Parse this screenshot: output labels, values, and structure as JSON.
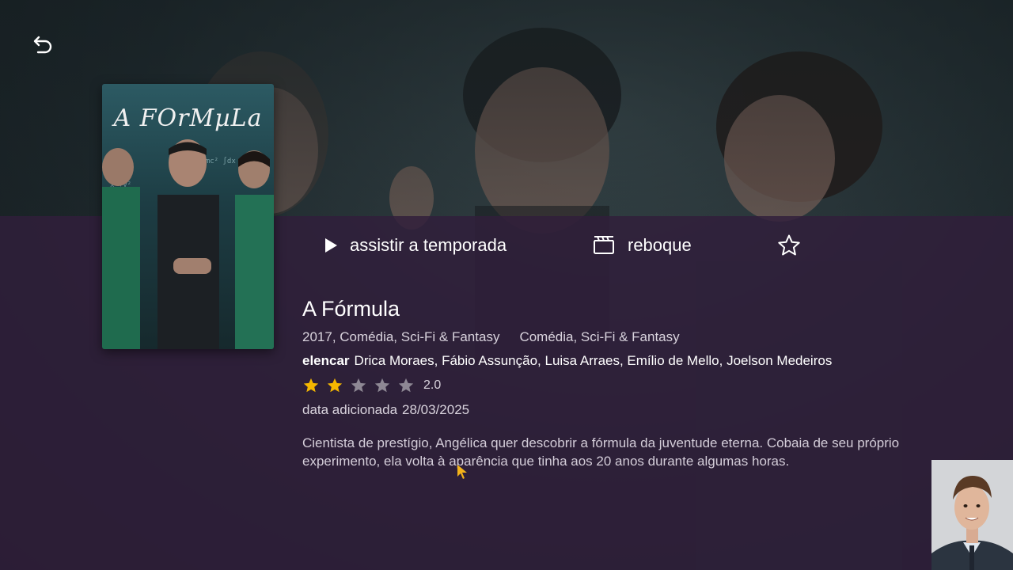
{
  "show": {
    "title": "A Fórmula",
    "poster_title": "A FOrMµLa",
    "year_genres": "2017, Comédia, Sci-Fi & Fantasy",
    "genres": "Comédia, Sci-Fi & Fantasy",
    "cast_label": "elencar",
    "cast": "Drica Moraes, Fábio Assunção, Luisa Arraes, Emílio de Mello, Joelson Medeiros",
    "rating": 2.0,
    "rating_text": "2.0",
    "rating_max_stars": 5,
    "date_label": "data adicionada",
    "date_added": "28/03/2025",
    "synopsis": "Cientista de prestígio, Angélica quer descobrir a fórmula da juventude eterna. Cobaia de seu próprio experimento, ela volta à aparência que tinha aos 20 anos durante algumas horas."
  },
  "actions": {
    "play_label": "assistir a temporada",
    "trailer_label": "reboque"
  },
  "icons": {
    "back": "back-arrow-icon",
    "play": "play-icon",
    "trailer": "clapperboard-icon",
    "favorite": "star-outline-icon"
  },
  "colors": {
    "overlay": "#301e3a",
    "star_filled": "#f5b800",
    "star_empty": "#8e8894",
    "text_primary": "#ffffff",
    "text_secondary": "#d9d3dd"
  }
}
